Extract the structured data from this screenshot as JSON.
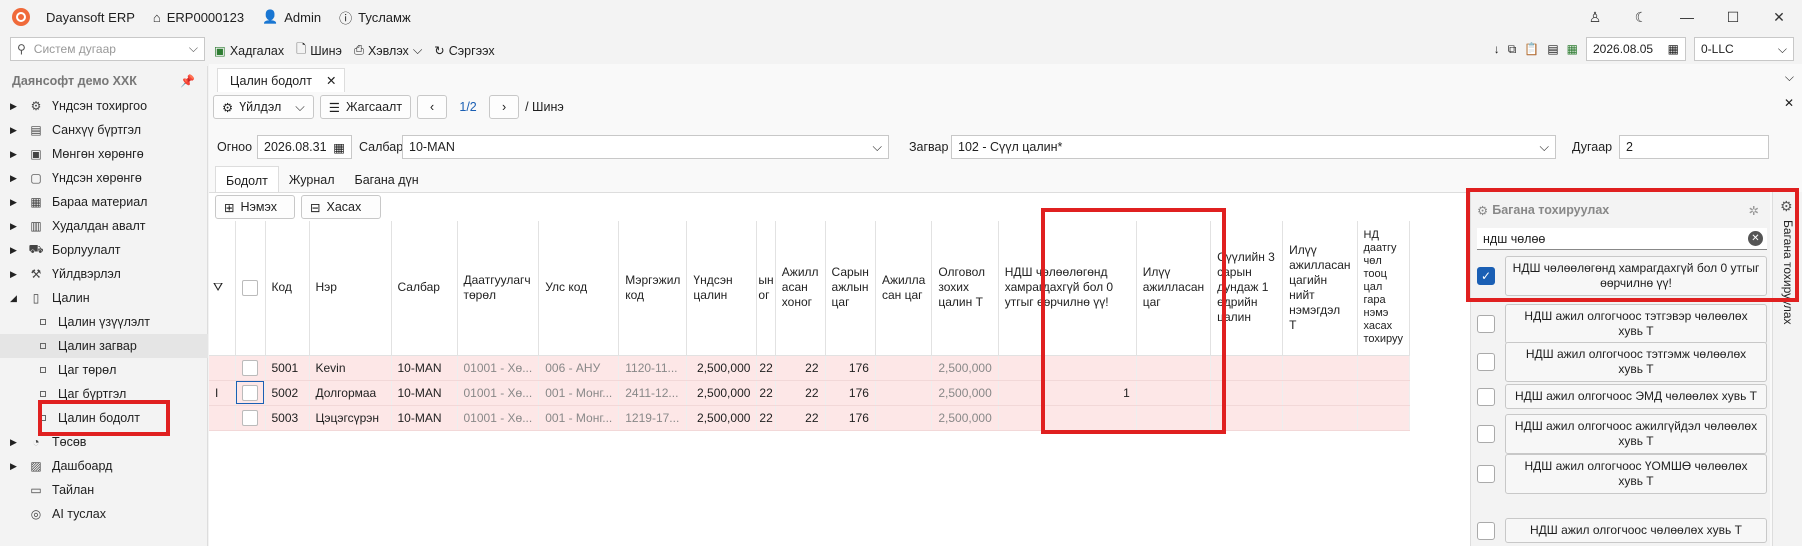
{
  "titlebar": {
    "app_name": "Dayansoft ERP",
    "doc_id": "ERP0000123",
    "user": "Admin",
    "help": "Тусламж"
  },
  "toolbar": {
    "search_placeholder": "Систем дугаар",
    "save": "Хадгалах",
    "new": "Шинэ",
    "print": "Хэвлэх",
    "refresh": "Сэргээх",
    "date": "2026.08.05",
    "company_code": "0-LLC"
  },
  "sidebar": {
    "company": "Даянсофт демо ХХК",
    "items": [
      {
        "label": "Үндсэн тохиргоо",
        "icon": "gear-icon",
        "glyph": "⚙"
      },
      {
        "label": "Санхүү бүртгэл",
        "icon": "ledger-icon",
        "glyph": "▤"
      },
      {
        "label": "Мөнгөн хөрөнгө",
        "icon": "money-icon",
        "glyph": "▣"
      },
      {
        "label": "Үндсэн хөрөнгө",
        "icon": "asset-icon",
        "glyph": "▢"
      },
      {
        "label": "Бараа материал",
        "icon": "box-icon",
        "glyph": "▦"
      },
      {
        "label": "Худалдан авалт",
        "icon": "purchase-icon",
        "glyph": "▥"
      },
      {
        "label": "Борлуулалт",
        "icon": "cart-icon",
        "glyph": "⛟"
      },
      {
        "label": "Үйлдвэрлэл",
        "icon": "factory-icon",
        "glyph": "⚒"
      },
      {
        "label": "Цалин",
        "icon": "payroll-icon",
        "glyph": "▯"
      }
    ],
    "children": [
      "Цалин үзүүлэлт",
      "Цалин загвар",
      "Цаг төрөл",
      "Цаг бүртгэл",
      "Цалин бодолт"
    ],
    "bottom": [
      {
        "label": "Төсөв",
        "icon": "budget-icon",
        "glyph": "◔"
      },
      {
        "label": "Дашбоард",
        "icon": "dashboard-icon",
        "glyph": "▨"
      },
      {
        "label": "Тайлан",
        "icon": "report-icon",
        "glyph": "▭"
      },
      {
        "label": "AI туслах",
        "icon": "ai-icon",
        "glyph": "◎"
      }
    ]
  },
  "doc_tab": "Цалин бодолт",
  "nav": {
    "actions": "Үйлдэл",
    "list": "Жагсаалт",
    "page": "1/2",
    "crumb": "/ Шинэ"
  },
  "form": {
    "date_label": "Огноо",
    "date_value": "2026.08.31",
    "branch_label": "Салбар",
    "branch_value": "10-MAN",
    "template_label": "Загвар",
    "template_value": "102 - Сүүл цалин*",
    "number_label": "Дугаар",
    "number_value": "2"
  },
  "subtabs": [
    "Бодолт",
    "Журнал",
    "Багана дүн"
  ],
  "grid_actions": {
    "add": "Нэмэх",
    "remove": "Хасах"
  },
  "columns": [
    "Код",
    "Нэр",
    "Салбар",
    "Даатгуулагч төрөл",
    "Улс код",
    "Мэргэжил код",
    "Үндсэн цалин",
    "ын ог",
    "Ажилл асан хоног",
    "Сарын ажлын цаг",
    "Ажилла сан цаг",
    "Олговол зохих цалин Т",
    "НДШ чөлөөлөгөнд хамрагдахгүй бол 0 утгыг өөрчилнө үү!",
    "Илүү ажилласан цаг",
    "Сүүлийн 3 сарын дундаж 1 өдрийн цалин",
    "Илүү ажилласан цагийн нийт нэмэгдэл Т",
    "НД даатгу чөл тооц цал гара нэмэ хасах тохируу"
  ],
  "rows": [
    {
      "code": "5001",
      "name": "Kevin",
      "branch": "10-MAN",
      "ins": "01001 - Хө...",
      "country": "006 - АНУ",
      "prof": "1120-11...",
      "salary": "2,500,000",
      "c8": "22",
      "days": "22",
      "hours": "176",
      "worked": "",
      "due": "2,500,000",
      "ndsh": "",
      "marker": ""
    },
    {
      "code": "5002",
      "name": "Долгормаа",
      "branch": "10-MAN",
      "ins": "01001 - Хө...",
      "country": "001 - Монг...",
      "prof": "2411-12...",
      "salary": "2,500,000",
      "c8": "22",
      "days": "22",
      "hours": "176",
      "worked": "",
      "due": "2,500,000",
      "ndsh": "1",
      "marker": "I"
    },
    {
      "code": "5003",
      "name": "Цэцэгсүрэн",
      "branch": "10-MAN",
      "ins": "01001 - Хө...",
      "country": "001 - Монг...",
      "prof": "1219-17...",
      "salary": "2,500,000",
      "c8": "22",
      "days": "22",
      "hours": "176",
      "worked": "",
      "due": "2,500,000",
      "ndsh": "",
      "marker": ""
    }
  ],
  "column_panel": {
    "title": "Багана тохируулах",
    "search_value": "ндш чөлөө",
    "vertical_label": "Багана тохируулах",
    "items": [
      {
        "label": "НДШ чөлөөлөгөнд хамрагдахгүй бол 0 утгыг өөрчилнө үү!",
        "checked": true
      },
      {
        "label": "НДШ ажил олгогчоос тэтгэвэр чөлөөлөх хувь Т",
        "checked": false
      },
      {
        "label": "НДШ ажил олгогчоос тэтгэмж чөлөөлөх хувь Т",
        "checked": false
      },
      {
        "label": "НДШ ажил олгогчоос ЭМД чөлөөлөх хувь Т",
        "checked": false
      },
      {
        "label": "НДШ ажил олгогчоос ажилгүйдэл чөлөөлөх хувь Т",
        "checked": false
      },
      {
        "label": "НДШ ажил олгогчоос ҮОМШӨ чөлөөлөх хувь Т",
        "checked": false
      },
      {
        "label": "НДШ ажил олгогчоос чөлөөлөх хувь Т",
        "checked": false
      }
    ]
  },
  "colors": {
    "highlight_box": "#e02020",
    "row_bg": "#fde7e7",
    "accent": "#1a5fb4"
  }
}
